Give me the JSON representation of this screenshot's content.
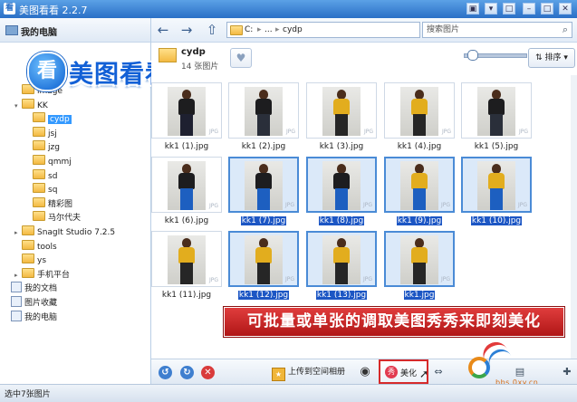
{
  "window": {
    "title": "美图看看 2.2.7",
    "app_icon": "看"
  },
  "left": {
    "header": "我的电脑",
    "tree": [
      {
        "label": "image",
        "depth": 1,
        "expander": ""
      },
      {
        "label": "KK",
        "depth": 1,
        "expander": "▾"
      },
      {
        "label": "cydp",
        "depth": 2,
        "expander": "",
        "selected": true
      },
      {
        "label": "jsj",
        "depth": 2,
        "expander": ""
      },
      {
        "label": "jzg",
        "depth": 2,
        "expander": ""
      },
      {
        "label": "qmmj",
        "depth": 2,
        "expander": ""
      },
      {
        "label": "sd",
        "depth": 2,
        "expander": ""
      },
      {
        "label": "sq",
        "depth": 2,
        "expander": ""
      },
      {
        "label": "精彩图",
        "depth": 2,
        "expander": ""
      },
      {
        "label": "马尔代夫",
        "depth": 2,
        "expander": ""
      },
      {
        "label": "SnagIt Studio 7.2.5",
        "depth": 1,
        "expander": "▸"
      },
      {
        "label": "tools",
        "depth": 1,
        "expander": ""
      },
      {
        "label": "ys",
        "depth": 1,
        "expander": ""
      },
      {
        "label": "手机平台",
        "depth": 1,
        "expander": "▸"
      },
      {
        "label": "我的文档",
        "depth": 0,
        "expander": "",
        "doc": true
      },
      {
        "label": "图片收藏",
        "depth": 0,
        "expander": "",
        "doc": true
      },
      {
        "label": "我的电脑",
        "depth": 0,
        "expander": "",
        "doc": true
      }
    ]
  },
  "logo": {
    "badge": "看",
    "text": "美图看看"
  },
  "nav": {
    "back_icon": "←",
    "forward_icon": "→",
    "up_icon": "⇧",
    "address": [
      "C:",
      "...",
      "cydp"
    ],
    "search_placeholder": "搜索图片",
    "search_icon": "⌕"
  },
  "folder": {
    "name": "cydp",
    "count": "14 张图片",
    "fav_icon": "♥",
    "sort_label": "排序"
  },
  "thumbnails": [
    {
      "name": "kk1 (1).jpg",
      "selected": false,
      "top": "#1d1d1f",
      "pants": "#1e2030"
    },
    {
      "name": "kk1 (2).jpg",
      "selected": false,
      "top": "#1d1d1f",
      "pants": "#2a2f3a"
    },
    {
      "name": "kk1 (3).jpg",
      "selected": false,
      "top": "#e2ad1e",
      "pants": "#262626"
    },
    {
      "name": "kk1 (4).jpg",
      "selected": false,
      "top": "#e2ad1e",
      "pants": "#262626"
    },
    {
      "name": "kk1 (5).jpg",
      "selected": false,
      "top": "#1d1d1f",
      "pants": "#2a2f3a"
    },
    {
      "name": "kk1 (6).jpg",
      "selected": false,
      "top": "#1d1d1f",
      "pants": "#1d5fc0"
    },
    {
      "name": "kk1 (7).jpg",
      "selected": true,
      "top": "#1d1d1f",
      "pants": "#1d5fc0"
    },
    {
      "name": "kk1 (8).jpg",
      "selected": true,
      "top": "#1d1d1f",
      "pants": "#1d5fc0"
    },
    {
      "name": "kk1 (9).jpg",
      "selected": true,
      "top": "#e2ad1e",
      "pants": "#1d5fc0"
    },
    {
      "name": "kk1 (10).jpg",
      "selected": true,
      "top": "#e2ad1e",
      "pants": "#1d5fc0"
    },
    {
      "name": "kk1 (11).jpg",
      "selected": false,
      "top": "#e2ad1e",
      "pants": "#262626"
    },
    {
      "name": "kk1 (12).jpg",
      "selected": true,
      "top": "#e2ad1e",
      "pants": "#262626"
    },
    {
      "name": "kk1 (13).jpg",
      "selected": true,
      "top": "#e2ad1e",
      "pants": "#262626"
    },
    {
      "name": "kk1.jpg",
      "selected": true,
      "top": "#e2ad1e",
      "pants": "#262626"
    }
  ],
  "thumb_tag": "JPG",
  "banner": "可批量或单张的调取美图秀秀来即刻美化",
  "bottom": {
    "rotate_left_icon": "↺",
    "rotate_right_icon": "↻",
    "delete_icon": "✕",
    "upload_label": "上传到空间相册",
    "weibo_icon": "◉",
    "beautify_label": "美化",
    "beautify_icon": "秀"
  },
  "watermark": {
    "site": "bbs.0xy.cn"
  },
  "status": "选中7张图片",
  "colors": {
    "accent": "#2a6fc6",
    "selection": "#1c56c4",
    "banner_red": "#c41e1e"
  }
}
